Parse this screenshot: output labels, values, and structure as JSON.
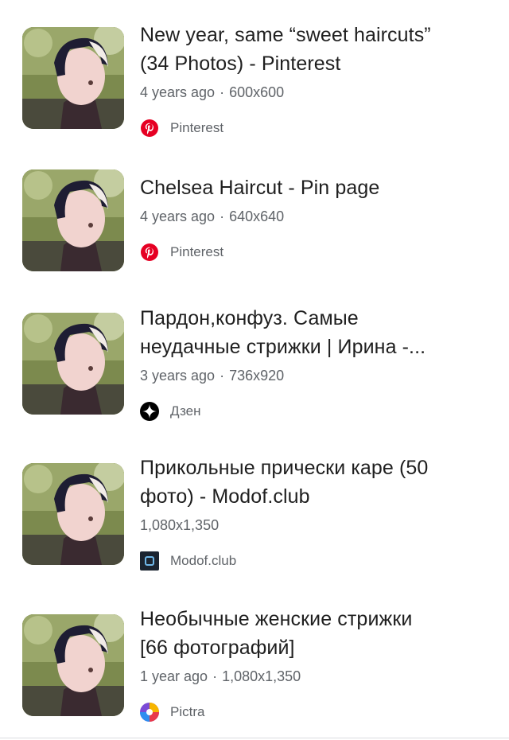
{
  "results": [
    {
      "title_line1": "New year, same “sweet haircuts”",
      "title_line2": "(34 Photos) - Pinterest",
      "age": "4 years ago",
      "separator": "·",
      "dimensions": "600x600",
      "source": "Pinterest",
      "source_icon": "pinterest-icon"
    },
    {
      "title_line1": "Chelsea Haircut - Pin page",
      "title_line2": "",
      "age": "4 years ago",
      "separator": "·",
      "dimensions": "640x640",
      "source": "Pinterest",
      "source_icon": "pinterest-icon"
    },
    {
      "title_line1": "Пардон,конфуз. Самые",
      "title_line2": "неудачные стрижки | Ирина -...",
      "age": "3 years ago",
      "separator": "·",
      "dimensions": "736x920",
      "source": "Дзен",
      "source_icon": "dzen-icon"
    },
    {
      "title_line1": "Прикольные прически каре (50",
      "title_line2": "фото) - Modof.club",
      "age": "",
      "separator": "",
      "dimensions": "1,080x1,350",
      "source": "Modof.club",
      "source_icon": "modof-icon"
    },
    {
      "title_line1": "Необычные женские стрижки",
      "title_line2": "[66 фотографий]",
      "age": "1 year ago",
      "separator": "·",
      "dimensions": "1,080x1,350",
      "source": "Pictra",
      "source_icon": "pictra-icon"
    }
  ],
  "colors": {
    "pinterest": "#e60023",
    "dzen": "#000000",
    "modof": "#1b2430",
    "title": "#1f1f1f",
    "meta": "#5f6368"
  }
}
